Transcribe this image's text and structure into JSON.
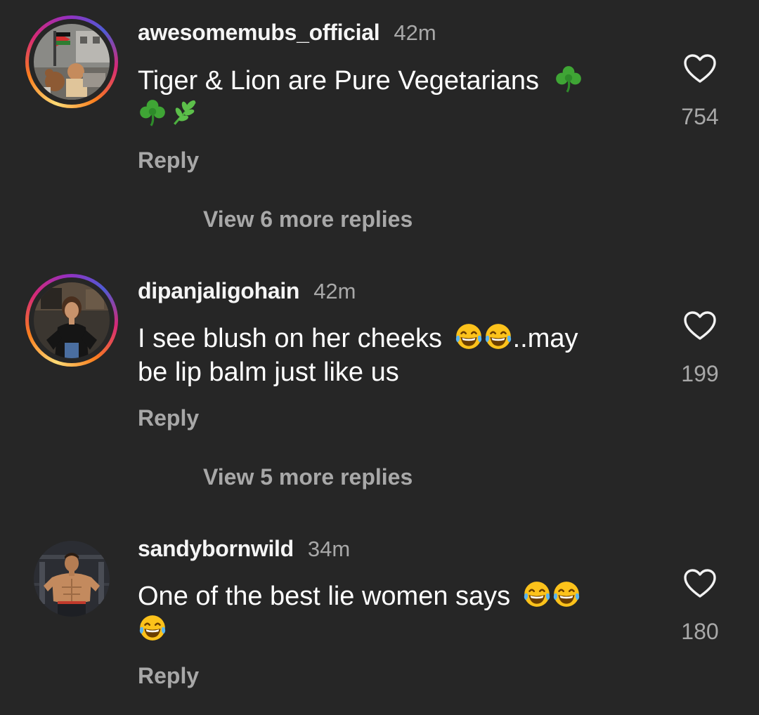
{
  "comments": [
    {
      "username": "awesomemubs_official",
      "time": "42m",
      "text_line1": "Tiger & Lion are Pure Vegetarians",
      "emojis": [
        "shamrock-emoji",
        "shamrock-emoji",
        "herb-emoji"
      ],
      "reply_label": "Reply",
      "likes": "754",
      "view_more": "View 6 more replies",
      "has_story_ring": true
    },
    {
      "username": "dipanjaligohain",
      "time": "42m",
      "text_part1": "I see blush on her cheeks",
      "text_part2": "..may",
      "text_line2": "be lip balm just like us",
      "emojis": [
        "tears-of-joy-emoji",
        "tears-of-joy-emoji"
      ],
      "reply_label": "Reply",
      "likes": "199",
      "view_more": "View 5 more replies",
      "has_story_ring": true
    },
    {
      "username": "sandybornwild",
      "time": "34m",
      "text_line1": "One of the best lie women says",
      "emojis": [
        "tears-of-joy-emoji",
        "tears-of-joy-emoji",
        "tears-of-joy-emoji"
      ],
      "reply_label": "Reply",
      "likes": "180",
      "has_story_ring": false
    }
  ],
  "colors": {
    "background": "#262626",
    "primary_text": "#ffffff",
    "secondary_text": "#a8a8a8"
  }
}
